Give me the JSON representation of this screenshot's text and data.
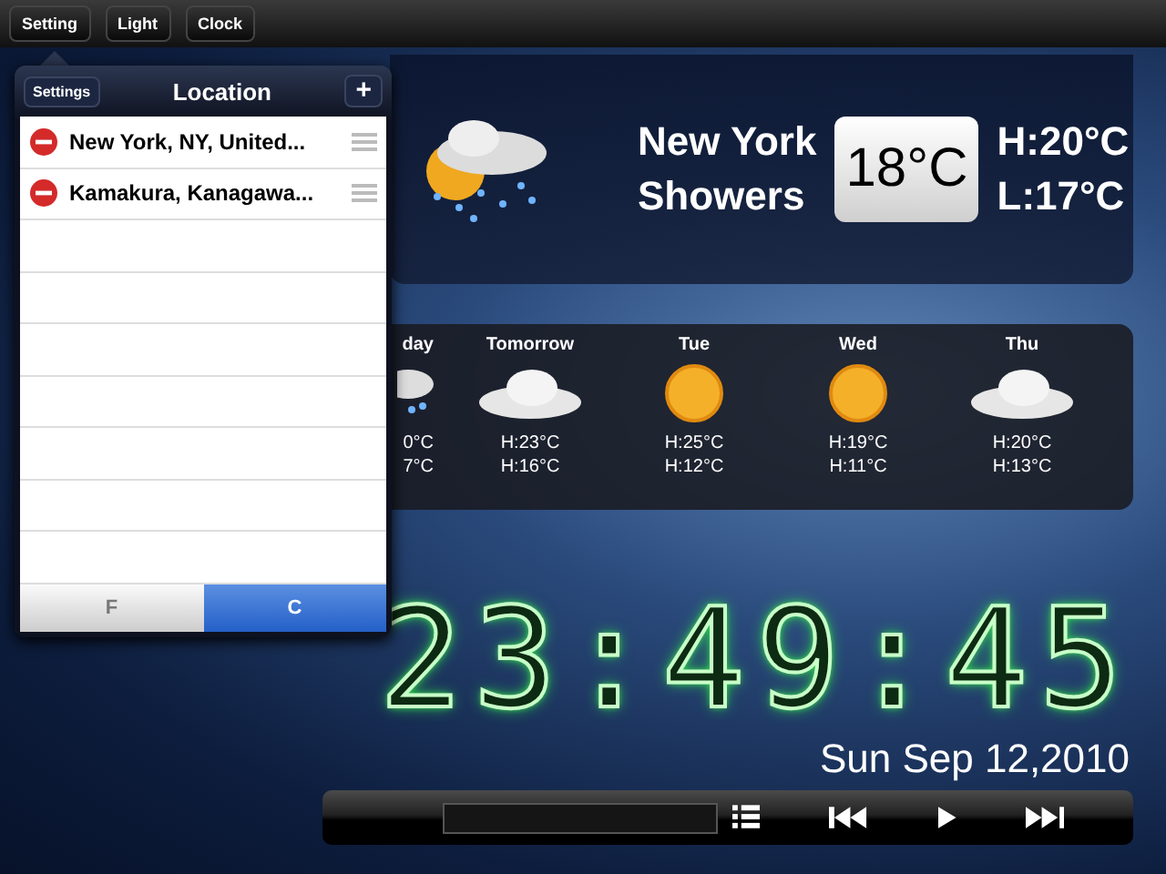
{
  "top_buttons": [
    "Setting",
    "Light",
    "Clock"
  ],
  "popover": {
    "back_button": "Settings",
    "title": "Location",
    "add_button": "+",
    "locations": [
      {
        "name": "New York, NY, United..."
      },
      {
        "name": "Kamakura, Kanagawa..."
      }
    ],
    "units": [
      {
        "label": "F",
        "selected": false
      },
      {
        "label": "C",
        "selected": true
      }
    ]
  },
  "current": {
    "kind": "showers",
    "city": "New York",
    "condition": "Showers",
    "temperature": "18°C",
    "high": "H:20°C",
    "low": "L:17°C"
  },
  "forecast": [
    {
      "kind": "showers",
      "day": "day",
      "high": "0°C",
      "low": "7°C"
    },
    {
      "kind": "cloudy",
      "day": "Tomorrow",
      "high": "H:23°C",
      "low": "H:16°C"
    },
    {
      "kind": "sunny",
      "day": "Tue",
      "high": "H:25°C",
      "low": "H:12°C"
    },
    {
      "kind": "sunny",
      "day": "Wed",
      "high": "H:19°C",
      "low": "H:11°C"
    },
    {
      "kind": "cloudy",
      "day": "Thu",
      "high": "H:20°C",
      "low": "H:13°C"
    }
  ],
  "clock": {
    "time": "23:49:45",
    "date": "Sun Sep 12,2010"
  }
}
